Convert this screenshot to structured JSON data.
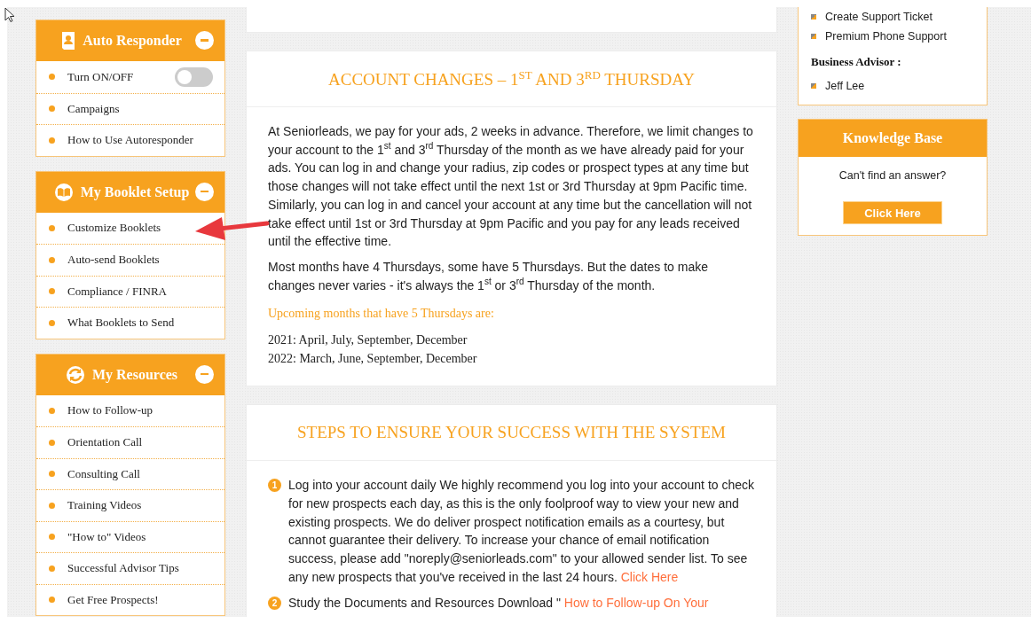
{
  "sidebar": {
    "sections": [
      {
        "title": "Auto Responder",
        "kind": "card",
        "expanded": true,
        "items": [
          {
            "label": "Turn ON/OFF",
            "kind": "toggle",
            "on": false
          },
          {
            "label": "Campaigns",
            "kind": "link"
          },
          {
            "label": "How to Use Autoresponder",
            "kind": "link"
          }
        ]
      },
      {
        "title": "My Booklet Setup",
        "kind": "book",
        "expanded": true,
        "items": [
          {
            "label": "Customize Booklets",
            "kind": "link"
          },
          {
            "label": "Auto-send Booklets",
            "kind": "link"
          },
          {
            "label": "Compliance / FINRA",
            "kind": "link"
          },
          {
            "label": "What Booklets to Send",
            "kind": "link"
          }
        ]
      },
      {
        "title": "My Resources",
        "kind": "refresh",
        "expanded": true,
        "items": [
          {
            "label": "How to Follow-up",
            "kind": "link"
          },
          {
            "label": "Orientation Call",
            "kind": "link"
          },
          {
            "label": "Consulting Call",
            "kind": "link"
          },
          {
            "label": "Training Videos",
            "kind": "link"
          },
          {
            "label": "\"How to\" Videos",
            "kind": "link"
          },
          {
            "label": "Successful Advisor Tips",
            "kind": "link"
          },
          {
            "label": "Get Free Prospects!",
            "kind": "link"
          }
        ]
      }
    ]
  },
  "account_changes": {
    "title": "ACCOUNT CHANGES – 1$^{ST}$ AND 3$^{RD}$ THURSDAY",
    "paragraphs": [
      "At Seniorleads, we pay for your ads, 2 weeks in advance. Therefore, we limit changes to your account to the 1$^{st}$ and 3$^{rd}$ Thursday of the month as we have already paid for your ads. You can log in and change your radius, zip codes or prospect types at any time but those changes will not take effect until the next 1st or 3rd Thursday at 9pm Pacific time. Similarly, you can log in and cancel your account at any time but the cancellation will not take effect until 1st or 3rd Thursday at 9pm Pacific and you pay for any leads received until the effective time.",
      "Most months have 4 Thursdays, some have 5 Thursdays. But the dates to make changes never varies - it's always the 1$^{st}$ or 3$^{rd}$ Thursday of the month."
    ],
    "subheading": "Upcoming months that have 5 Thursdays are:",
    "years": [
      "2021: April, July, September, December",
      "2022: March, June, September, December"
    ]
  },
  "steps": {
    "title": "STEPS TO ENSURE YOUR SUCCESS WITH THE SYSTEM",
    "items": [
      {
        "number": "1",
        "text": "Log into your account daily We highly recommend you log into your account to check for new prospects each day, as this is the only foolproof way to view your new and existing prospects. We do deliver prospect notification emails as a courtesy, but cannot guarantee their delivery. To increase your chance of email notification success, please add \"noreply@seniorleads.com\" to your allowed sender list. To see any new prospects that you've received in the last 24 hours.",
        "link": "Click Here"
      },
      {
        "number": "2",
        "text": "Study the Documents and Resources Download \"",
        "link": "How to Follow-up On Your"
      }
    ]
  },
  "support": {
    "items": [
      "Create Support Ticket",
      "Premium Phone Support"
    ],
    "advisor_heading": "Business Advisor :",
    "advisors": [
      "Jeff Lee"
    ]
  },
  "knowledge_base": {
    "title": "Knowledge Base",
    "prompt": "Can't find an answer?",
    "button": "Click Here"
  }
}
